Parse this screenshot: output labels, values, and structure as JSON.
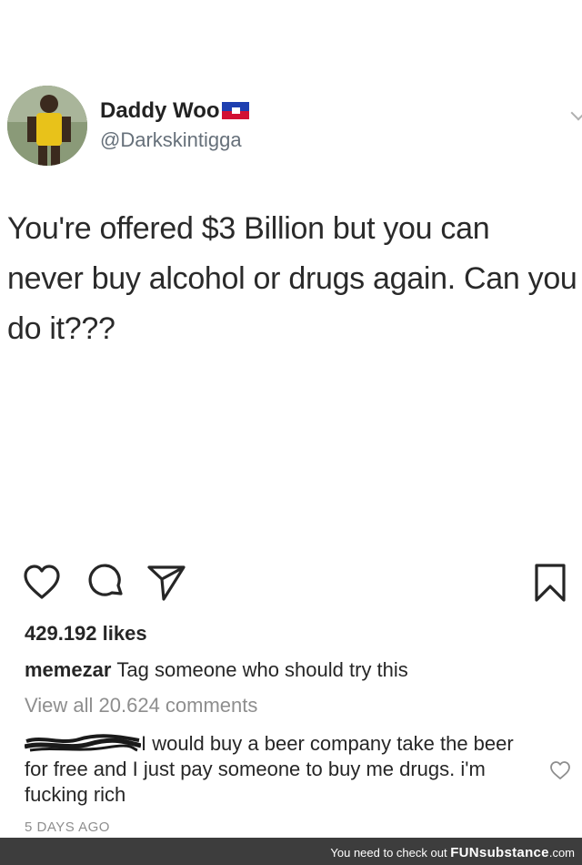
{
  "tweet": {
    "display_name": "Daddy Woo",
    "handle": "@Darkskintigga",
    "text": "You're offered $3 Billion but you can\nnever buy alcohol or drugs again. Can you\ndo it???",
    "flag_icon": "haiti-flag-icon"
  },
  "post": {
    "likes": "429.192 likes",
    "caption_user": "memezar",
    "caption_text": "Tag someone who should try this",
    "view_all": "View all 20.624 comments",
    "comment_text": "I would buy a beer company take the beer for free and I just pay someone to buy me drugs. i'm fucking rich",
    "timestamp": "5 DAYS AGO"
  },
  "footer": {
    "prefix": "You need to check out",
    "brand": "FUNsubstance",
    "suffix": ".com"
  },
  "icons": [
    "heart-icon",
    "comment-icon",
    "share-icon",
    "bookmark-icon",
    "small-heart-icon",
    "chevron-down-icon"
  ]
}
